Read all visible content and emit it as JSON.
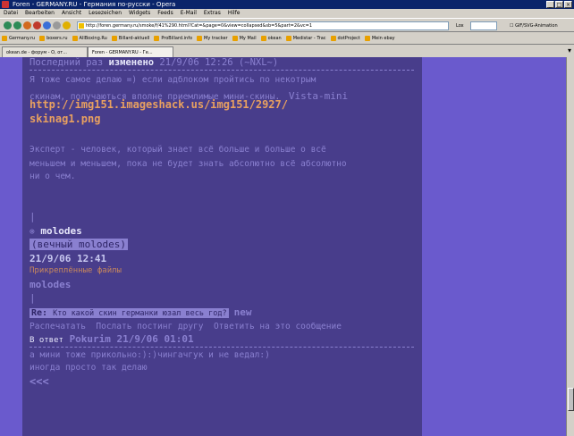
{
  "window": {
    "title": "Foren - GERMANY.RU - Германия по-русски - Opera"
  },
  "menu": [
    "Datei",
    "Bearbeiten",
    "Ansicht",
    "Lesezeichen",
    "Widgets",
    "Feeds",
    "E-Mail",
    "Extras",
    "Hilfe"
  ],
  "address": {
    "url": "http://foren.germany.ru/smoke/f/41%290.html?Cat=&page=0&view=collapsed&sb=5&part=2&vc=1"
  },
  "search": {
    "label": "Lox"
  },
  "gif_label": "GIF/SVG-Animation",
  "bookmarks": [
    "Germany.ru",
    "boxers.ru",
    "AllBoxing.Ru",
    "Billard-aktuell",
    "ProBillard.info",
    "My tracker",
    "My Mail",
    "okean",
    "Medistar - Trac",
    "dotProject",
    "Mein ebay"
  ],
  "tabs": [
    {
      "label": "okean.de - форум - О, от..."
    },
    {
      "label": "Foren - GERMANY.RU - Ге..."
    }
  ],
  "post": {
    "edited_prefix": "Последний раз",
    "edited_word": "изменено",
    "edited_date": "21/9/06 12:26 (~NXL~)",
    "body_line1": "Я тоже самое делаю =) если адблоком пройтись по некотрым",
    "body_line2_a": "скинам, получаються вполне приемлимые мини-скины.",
    "body_line2_b": "Vista-mini",
    "link_line1": "http://img151.imageshack.us/img151/2927/",
    "link_line2": "skinag1.png",
    "sig_line1": "Эксперт - человек, который знает всё больше и больше о всё",
    "sig_line2": "меньшем и меньшем, пока не будет знать абсолютно всё абсолютно",
    "sig_line3": "ни о чем."
  },
  "reply": {
    "icon": "⊗",
    "author": "molodes",
    "status": "(вечный molodes)",
    "date": "21/9/06 12:41",
    "attach_label": "Прикреплённые файлы",
    "attach_name": "molodes",
    "pipe": "|"
  },
  "next_post": {
    "re_label": "Re:",
    "subject": "Кто какой скин германки юзал весь год?",
    "new_badge": "new",
    "actions": [
      "Распечатать",
      "Послать постинг другу",
      "Ответить на это сообщение"
    ],
    "answer_prefix": "В ответ",
    "answer_author": "Pokurim",
    "answer_date": "21/9/06 01:01",
    "text_line1": "а мини тоже прикольно:):)чингачгук и не ведал:)",
    "text_line2": "иногда просто так делаю",
    "back": "<<<"
  }
}
